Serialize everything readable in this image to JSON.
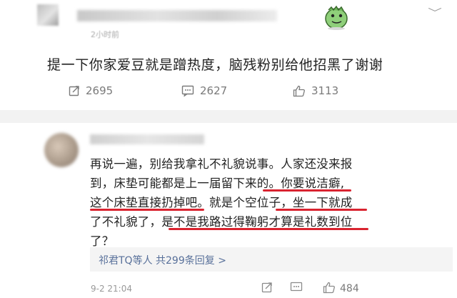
{
  "post": {
    "time": "2小时前",
    "text": "提一下你家爱豆就是蹭热度，脑残粉别给他招黑了谢谢",
    "actions": {
      "share_count": "2695",
      "comment_count": "2627",
      "like_count": "3113"
    }
  },
  "comment": {
    "lines": [
      "再说一遍，别给我拿礼不礼貌说事。人家还没来报",
      "到，床垫可能都是上一届留下来的。你要说洁癖,",
      "这个床垫直接扔掉吧。就是个空位子，坐一下就成",
      "了不礼貌了，是不是我路过得鞠躬才算是礼数到位",
      "了？"
    ],
    "reply_summary": "祁君TQ等人 共299条回复 >",
    "time": "9-2 21:04",
    "like_count": "484"
  },
  "colors": {
    "underline": "#d9232f",
    "link": "#58709a"
  }
}
